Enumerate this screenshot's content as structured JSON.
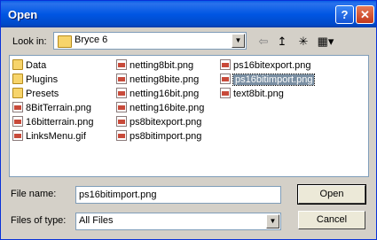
{
  "window": {
    "title": "Open",
    "help": "?",
    "close": "✕"
  },
  "lookin": {
    "label": "Look in:",
    "value": "Bryce  6"
  },
  "toolbar": {
    "back": "⇦",
    "up": "↥",
    "newfolder": "✳",
    "views": "▦▾"
  },
  "files": {
    "col1": [
      {
        "name": "Data",
        "kind": "folder"
      },
      {
        "name": "Plugins",
        "kind": "folder"
      },
      {
        "name": "Presets",
        "kind": "folder"
      },
      {
        "name": "8BitTerrain.png",
        "kind": "file"
      },
      {
        "name": "16bitterrain.png",
        "kind": "file"
      },
      {
        "name": "LinksMenu.gif",
        "kind": "file"
      }
    ],
    "col2": [
      {
        "name": "netting8bit.png",
        "kind": "file"
      },
      {
        "name": "netting8bite.png",
        "kind": "file"
      },
      {
        "name": "netting16bit.png",
        "kind": "file"
      },
      {
        "name": "netting16bite.png",
        "kind": "file"
      },
      {
        "name": "ps8bitexport.png",
        "kind": "file"
      },
      {
        "name": "ps8bitimport.png",
        "kind": "file"
      }
    ],
    "col3": [
      {
        "name": "ps16bitexport.png",
        "kind": "file"
      },
      {
        "name": "ps16bitimport.png",
        "kind": "file",
        "selected": true
      },
      {
        "name": "text8bit.png",
        "kind": "file"
      }
    ]
  },
  "filename": {
    "label": "File name:",
    "value": "ps16bitimport.png"
  },
  "filetype": {
    "label": "Files of type:",
    "value": "All Files"
  },
  "buttons": {
    "open": "Open",
    "cancel": "Cancel"
  }
}
